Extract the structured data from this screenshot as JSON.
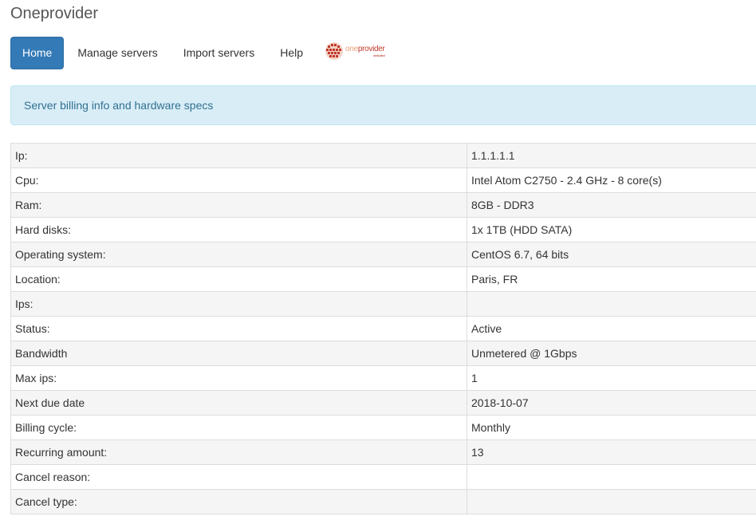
{
  "app": {
    "title": "Oneprovider"
  },
  "nav": {
    "items": [
      {
        "label": "Home",
        "active": true
      },
      {
        "label": "Manage servers",
        "active": false
      },
      {
        "label": "Import servers",
        "active": false
      },
      {
        "label": "Help",
        "active": false
      }
    ],
    "logo": {
      "text_light": "one",
      "text_bold": "provider",
      "sub": "dedicated",
      "icon": "globe-icon"
    }
  },
  "alert": {
    "text": "Server billing info and hardware specs"
  },
  "specs": {
    "rows": [
      {
        "label": "Ip:",
        "value": "1.1.1.1.1"
      },
      {
        "label": "Cpu:",
        "value": "Intel Atom C2750 - 2.4 GHz - 8 core(s)"
      },
      {
        "label": "Ram:",
        "value": "8GB - DDR3"
      },
      {
        "label": "Hard disks:",
        "value": "1x 1TB (HDD SATA)"
      },
      {
        "label": "Operating system:",
        "value": "CentOS 6.7, 64 bits"
      },
      {
        "label": "Location:",
        "value": "Paris, FR"
      },
      {
        "label": "Ips:",
        "value": ""
      },
      {
        "label": "Status:",
        "value": "Active"
      },
      {
        "label": "Bandwidth",
        "value": "Unmetered @ 1Gbps"
      },
      {
        "label": "Max ips:",
        "value": "1"
      },
      {
        "label": "Next due date",
        "value": "2018-10-07"
      },
      {
        "label": "Billing cycle:",
        "value": "Monthly"
      },
      {
        "label": "Recurring amount:",
        "value": "13"
      },
      {
        "label": "Cancel reason:",
        "value": ""
      },
      {
        "label": "Cancel type:",
        "value": ""
      }
    ]
  },
  "colors": {
    "primary": "#337ab7",
    "alert_bg": "#d9edf7",
    "alert_text": "#31708f",
    "logo_red": "#c0392b"
  }
}
